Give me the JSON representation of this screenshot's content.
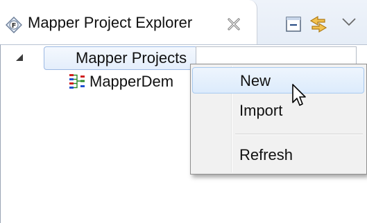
{
  "view": {
    "title": "Mapper Project Explorer",
    "title_icon": "mapper-explorer-icon",
    "close_icon": "close-icon",
    "toolbar": {
      "collapse_icon": "collapse-all-icon",
      "link_icon": "link-with-editor-icon",
      "menu_icon": "view-menu-chevron-icon"
    }
  },
  "tree": {
    "root": {
      "label": "Mapper Projects",
      "expanded": true,
      "expander_icon": "expanded-triangle-icon"
    },
    "children": [
      {
        "label": "MapperDem",
        "icon": "mapper-project-icon"
      }
    ]
  },
  "context_menu": {
    "items": [
      {
        "label": "New",
        "highlighted": true
      },
      {
        "label": "Import"
      },
      {
        "label": "Refresh"
      }
    ]
  },
  "colors": {
    "selection_border": "#9bb8e3",
    "menu_highlight": "#dcebfc",
    "menu_background": "#f1f1f1",
    "tab_bar": "#e6edf7"
  }
}
